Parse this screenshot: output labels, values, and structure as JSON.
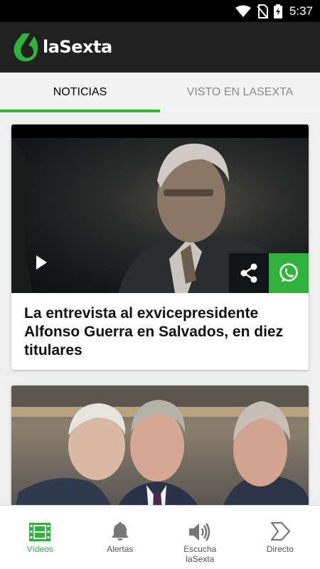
{
  "status_bar": {
    "time": "5:37"
  },
  "app": {
    "brand": "laSexta",
    "brand_color": "#2fb33c"
  },
  "tabs": [
    {
      "label": "NOTICIAS",
      "active": true
    },
    {
      "label": "VISTO EN LASEXTA",
      "active": false
    }
  ],
  "articles": [
    {
      "title": "La entrevista al exvicepresidente Alfonso Guerra en Salvados, en diez titulares",
      "media": "video"
    },
    {
      "title": "",
      "media": "photo"
    }
  ],
  "bottom_nav": [
    {
      "label": "Vídeos",
      "icon": "film-icon",
      "active": true
    },
    {
      "label": "Alertas",
      "icon": "bell-icon",
      "active": false
    },
    {
      "label": "Escucha laSexta",
      "icon": "speaker-icon",
      "active": false
    },
    {
      "label": "Directo",
      "icon": "live-arrow-icon",
      "active": false
    }
  ]
}
